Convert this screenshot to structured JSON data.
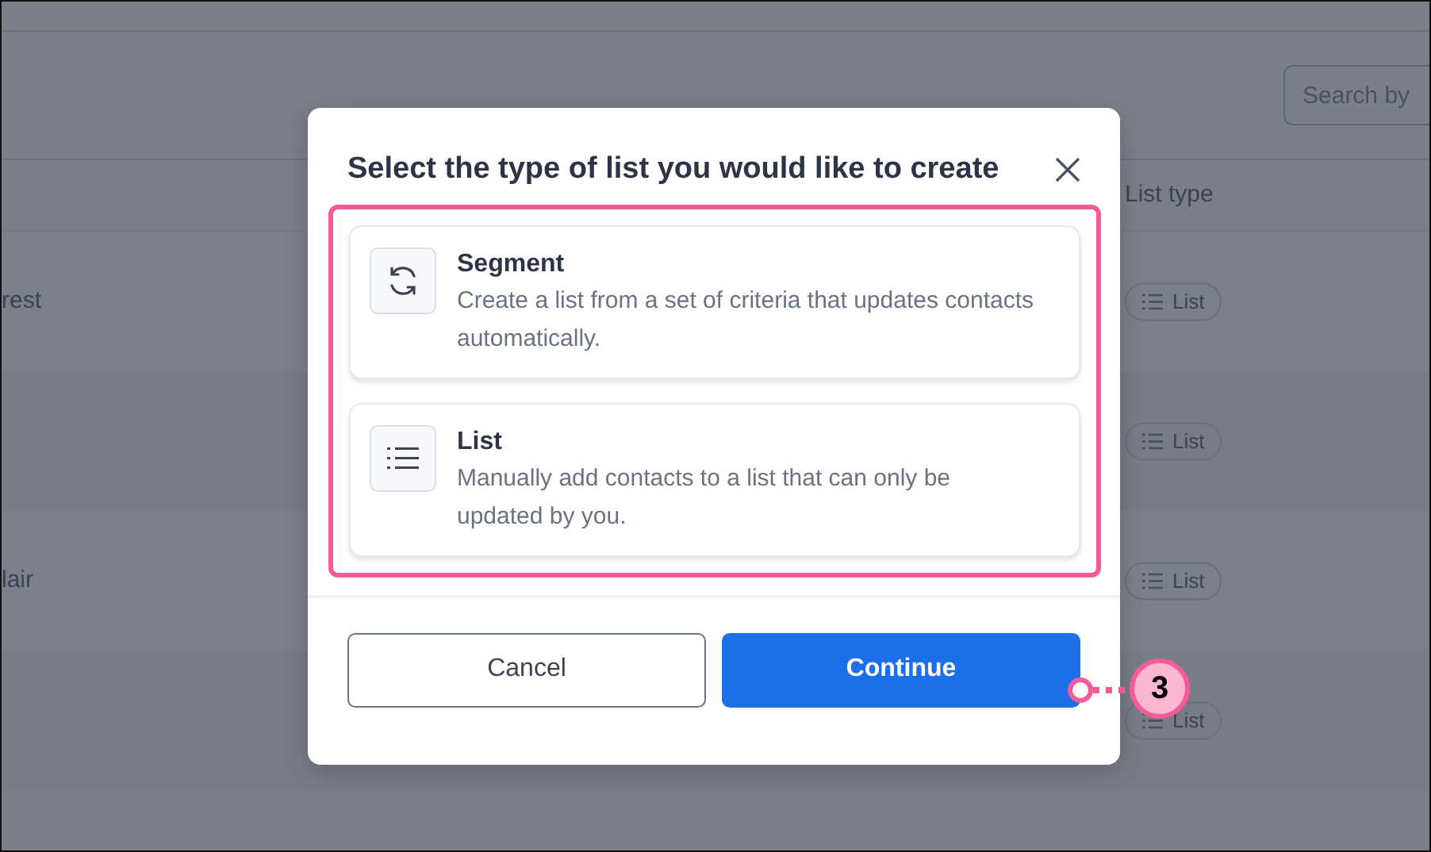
{
  "page": {
    "search": {
      "placeholder": "Search by"
    },
    "columns": [
      {
        "label": "List type"
      }
    ],
    "rows": [
      {
        "name": "rest",
        "list_type": "List"
      },
      {
        "list_type": "List"
      },
      {
        "name": "lair",
        "list_type": "List"
      },
      {
        "list_type": "List"
      }
    ]
  },
  "dialog": {
    "title": "Select the type of list you would like to create",
    "options": [
      {
        "kind": "segment",
        "title": "Segment",
        "description": "Create a list from a set of criteria that updates contacts automatically."
      },
      {
        "kind": "list",
        "title": "List",
        "description": "Manually add contacts to a list that can only be updated by you."
      }
    ],
    "buttons": [
      {
        "kind": "secondary",
        "label": "Cancel"
      },
      {
        "kind": "primary",
        "label": "Continue"
      }
    ]
  },
  "callout": {
    "label": "3"
  }
}
